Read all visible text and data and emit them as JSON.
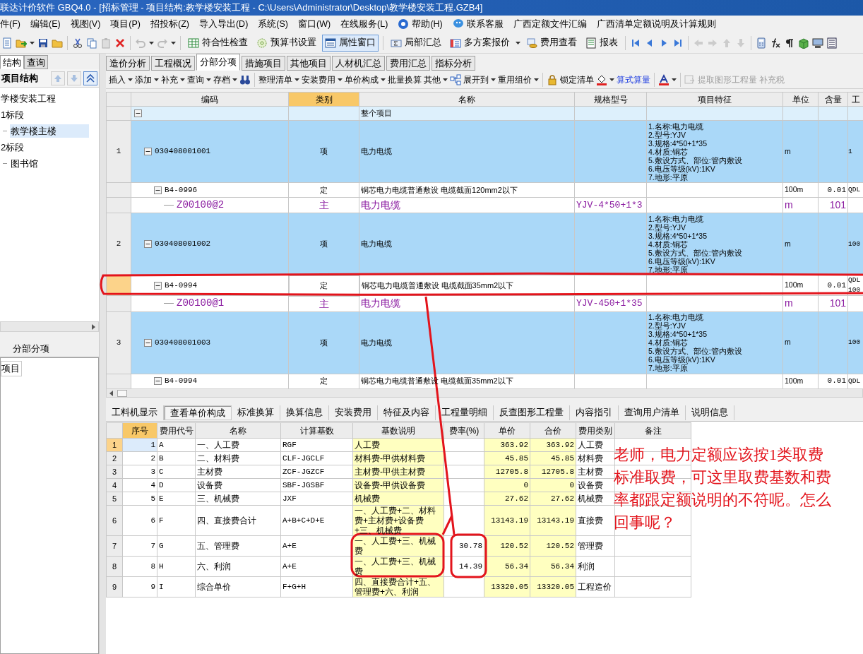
{
  "window": {
    "title": "联达计价软件 GBQ4.0 - [招标管理 - 项目结构:教学楼安装工程 - C:\\Users\\Administrator\\Desktop\\教学楼安装工程.GZB4]"
  },
  "menu": [
    "件(F)",
    "编辑(E)",
    "视图(V)",
    "项目(P)",
    "招投标(Z)",
    "导入导出(D)",
    "系统(S)",
    "窗口(W)",
    "在线服务(L)",
    "帮助(H)",
    "联系客服",
    "广西定额文件汇编",
    "广西清单定额说明及计算规则"
  ],
  "toolbar": [
    {
      "label": "符合性检查",
      "pressed": false
    },
    {
      "label": "预算书设置",
      "pressed": false
    },
    {
      "label": "属性窗口",
      "pressed": true
    },
    {
      "label": "局部汇总",
      "pressed": false
    },
    {
      "label": "多方案报价",
      "pressed": false
    },
    {
      "label": "费用查看",
      "pressed": false
    },
    {
      "label": "报表",
      "pressed": false
    }
  ],
  "left_panel": {
    "tabs": [
      {
        "label": "结构",
        "selected": true
      },
      {
        "label": "查询",
        "selected": false
      }
    ],
    "title": "项目结构",
    "tree": [
      {
        "label": "学楼安装工程",
        "selected": false,
        "children": [
          {
            "label": "1标段",
            "selected": false,
            "children": [
              {
                "label": "教学楼主楼",
                "selected": true
              }
            ]
          },
          {
            "label": "2标段",
            "selected": false,
            "children": [
              {
                "label": "图书馆",
                "selected": false
              }
            ]
          }
        ]
      }
    ],
    "section_title": "分部分项",
    "list": [
      "项目"
    ]
  },
  "tabs": [
    {
      "label": "造价分析",
      "selected": false
    },
    {
      "label": "工程概况",
      "selected": false
    },
    {
      "label": "分部分项",
      "selected": true
    },
    {
      "label": "措施项目",
      "selected": false
    },
    {
      "label": "其他项目",
      "selected": false
    },
    {
      "label": "人材机汇总",
      "selected": false
    },
    {
      "label": "费用汇总",
      "selected": false
    },
    {
      "label": "指标分析",
      "selected": false
    }
  ],
  "edit_toolbar": [
    {
      "label": "插入",
      "dropdown": true,
      "kind": "command",
      "disabled": false
    },
    {
      "label": "添加",
      "dropdown": true,
      "kind": "command",
      "disabled": false
    },
    {
      "label": "补充",
      "dropdown": true,
      "kind": "command",
      "disabled": false
    },
    {
      "label": "查询",
      "dropdown": true,
      "kind": "command",
      "disabled": false
    },
    {
      "label": "存档",
      "dropdown": true,
      "kind": "command",
      "disabled": false
    },
    {
      "label": "整理清单",
      "dropdown": true,
      "kind": "command",
      "disabled": false
    },
    {
      "label": "安装费用",
      "dropdown": true,
      "kind": "command",
      "disabled": false
    },
    {
      "label": "单价构成",
      "dropdown": true,
      "kind": "command",
      "disabled": false
    },
    {
      "label": "批量换算",
      "dropdown": false,
      "kind": "command",
      "disabled": false
    },
    {
      "label": "其他",
      "dropdown": true,
      "kind": "command",
      "disabled": false
    },
    {
      "label": "展开到",
      "dropdown": true,
      "kind": "command",
      "disabled": false
    },
    {
      "label": "重用组价",
      "dropdown": true,
      "kind": "command",
      "disabled": false
    },
    {
      "label": "锁定清单",
      "dropdown": false,
      "kind": "command",
      "disabled": false
    },
    {
      "label": "算式算量",
      "dropdown": false,
      "kind": "link",
      "disabled": false
    },
    {
      "label": "提取图形工程量",
      "dropdown": false,
      "kind": "command",
      "disabled": true
    },
    {
      "label": "补充税",
      "dropdown": false,
      "kind": "command",
      "disabled": true
    }
  ],
  "grid": {
    "columns": [
      {
        "label": "编码",
        "highlighted": false
      },
      {
        "label": "类别",
        "highlighted": true
      },
      {
        "label": "名称",
        "highlighted": false
      },
      {
        "label": "规格型号",
        "highlighted": false
      },
      {
        "label": "项目特征",
        "highlighted": false
      },
      {
        "label": "单位",
        "highlighted": false
      },
      {
        "label": "含量",
        "highlighted": false
      },
      {
        "label": "工",
        "highlighted": false
      }
    ],
    "rows": [
      {
        "kind": "root",
        "name": "整个项目",
        "expanded": true,
        "selected": false,
        "children": [
          {
            "kind": "item",
            "number": "1",
            "code": "030408001001",
            "type": "项",
            "name": "电力电缆",
            "features": [
              "1.名称:电力电缆",
              "2.型号:YJV",
              "3.规格:4*50+1*35",
              "4.材质:铜芯",
              "5.敷设方式、部位:管内敷设",
              "6.电压等级(kV):1KV",
              "7.地形:平原"
            ],
            "unit": "m",
            "column_9": "1",
            "expanded": true,
            "selected": false,
            "children": [
              {
                "kind": "quota",
                "code": "B4-0996",
                "type": "定",
                "name": "铜芯电力电缆普通敷设 电缆截面120mm2以下",
                "unit": "100m",
                "content": "0.01",
                "column_9": "QDL",
                "expanded": true,
                "selected": false,
                "children": [
                  {
                    "kind": "material",
                    "code": "Z00100@2",
                    "type": "主",
                    "name": "电力电缆",
                    "spec": "YJV-4*50+1*3",
                    "unit": "m",
                    "content": "101",
                    "selected": false
                  }
                ]
              }
            ]
          },
          {
            "kind": "item",
            "number": "2",
            "code": "030408001002",
            "type": "项",
            "name": "电力电缆",
            "features": [
              "1.名称:电力电缆",
              "2.型号:YJV",
              "3.规格:4*50+1*35",
              "4.材质:铜芯",
              "5.敷设方式、部位:管内敷设",
              "6.电压等级(kV):1KV",
              "7.地形:平原"
            ],
            "unit": "m",
            "column_9": "100",
            "expanded": true,
            "selected": false,
            "children": [
              {
                "kind": "quota",
                "code": "B4-0994",
                "type": "定",
                "name": "铜芯电力电缆普通敷设 电缆截面35mm2以下",
                "unit": "100m",
                "content": "0.01",
                "column_9": "QDL 100",
                "expanded": true,
                "selected": true,
                "children": [
                  {
                    "kind": "material",
                    "code": "Z00100@1",
                    "type": "主",
                    "name": "电力电缆",
                    "spec": "YJV-450+1*35",
                    "unit": "m",
                    "content": "101",
                    "selected": false
                  }
                ]
              }
            ]
          },
          {
            "kind": "item",
            "number": "3",
            "code": "030408001003",
            "type": "项",
            "name": "电力电缆",
            "features": [
              "1.名称:电力电缆",
              "2.型号:YJV",
              "3.规格:4*50+1*35",
              "4.材质:铜芯",
              "5.敷设方式、部位:管内敷设",
              "6.电压等级(kV):1KV",
              "7.地形:平原"
            ],
            "unit": "m",
            "column_9": "100",
            "expanded": true,
            "selected": false,
            "children": [
              {
                "kind": "quota",
                "code": "B4-0994",
                "type": "定",
                "name": "铜芯电力电缆普通敷设 电缆截面35mm2以下",
                "unit": "100m",
                "content": "0.01",
                "column_9": "QDL",
                "expanded": true,
                "selected": false
              }
            ]
          }
        ]
      }
    ]
  },
  "detail_tabs": [
    {
      "label": "工料机显示",
      "selected": false
    },
    {
      "label": "查看单价构成",
      "selected": true
    },
    {
      "label": "标准换算",
      "selected": false
    },
    {
      "label": "换算信息",
      "selected": false
    },
    {
      "label": "安装费用",
      "selected": false
    },
    {
      "label": "特征及内容",
      "selected": false
    },
    {
      "label": "工程量明细",
      "selected": false
    },
    {
      "label": "反查图形工程量",
      "selected": false
    },
    {
      "label": "内容指引",
      "selected": false
    },
    {
      "label": "查询用户清单",
      "selected": false
    },
    {
      "label": "说明信息",
      "selected": false
    }
  ],
  "cost_table": {
    "columns": [
      {
        "label": "序号",
        "highlighted": true,
        "shaded": false
      },
      {
        "label": "费用代号",
        "highlighted": false,
        "shaded": false
      },
      {
        "label": "名称",
        "highlighted": false,
        "shaded": false
      },
      {
        "label": "计算基数",
        "highlighted": false,
        "shaded": false
      },
      {
        "label": "基数说明",
        "highlighted": false,
        "shaded": true
      },
      {
        "label": "费率(%)",
        "highlighted": false,
        "shaded": false
      },
      {
        "label": "单价",
        "highlighted": false,
        "shaded": true
      },
      {
        "label": "合价",
        "highlighted": false,
        "shaded": true
      },
      {
        "label": "费用类别",
        "highlighted": false,
        "shaded": false
      },
      {
        "label": "备注",
        "highlighted": false,
        "shaded": false
      }
    ],
    "rows": [
      {
        "row": "1",
        "seq": "1",
        "code": "A",
        "name": "一、人工费",
        "base": "RGF",
        "desc": "人工费",
        "price": "363.92",
        "total": "363.92",
        "category": "人工费",
        "selected": true
      },
      {
        "row": "2",
        "seq": "2",
        "code": "B",
        "name": "二、材料费",
        "base": "CLF-JGCLF",
        "desc": "材料费-甲供材料费",
        "price": "45.85",
        "total": "45.85",
        "category": "材料费",
        "selected": false
      },
      {
        "row": "3",
        "seq": "3",
        "code": "C",
        "name": "主材费",
        "base": "ZCF-JGZCF",
        "desc": "主材费-甲供主材费",
        "price": "12705.8",
        "total": "12705.8",
        "category": "主材费",
        "selected": false
      },
      {
        "row": "4",
        "seq": "4",
        "code": "D",
        "name": "设备费",
        "base": "SBF-JGSBF",
        "desc": "设备费-甲供设备费",
        "price": "0",
        "total": "0",
        "category": "设备费",
        "selected": false
      },
      {
        "row": "5",
        "seq": "5",
        "code": "E",
        "name": "三、机械费",
        "base": "JXF",
        "desc": "机械费",
        "price": "27.62",
        "total": "27.62",
        "category": "机械费",
        "selected": false
      },
      {
        "row": "6",
        "seq": "6",
        "code": "F",
        "name": "四、直接费合计",
        "base": "A+B+C+D+E",
        "desc": "一、人工费+二、材料费+主材费+设备费+三、机械费",
        "price": "13143.19",
        "total": "13143.19",
        "category": "直接费",
        "selected": false
      },
      {
        "row": "7",
        "seq": "7",
        "code": "G",
        "name": "五、管理费",
        "base": "A+E",
        "desc": "一、人工费+三、机械费",
        "rate": "30.78",
        "price": "120.52",
        "total": "120.52",
        "category": "管理费",
        "selected": false
      },
      {
        "row": "8",
        "seq": "8",
        "code": "H",
        "name": "六、利润",
        "base": "A+E",
        "desc": "一、人工费+三、机械费",
        "rate": "14.39",
        "price": "56.34",
        "total": "56.34",
        "category": "利润",
        "selected": false
      },
      {
        "row": "9",
        "seq": "9",
        "code": "I",
        "name": "综合单价",
        "base": "F+G+H",
        "desc": "四、直接费合计+五、管理费+六、利润",
        "price": "13320.05",
        "total": "13320.05",
        "category": "工程造价",
        "selected": false
      }
    ]
  },
  "annotation": "老师，电力定额应该按1类取费标准取费，可这里取费基数和费率都跟定额说明的不符呢。怎么回事呢？"
}
